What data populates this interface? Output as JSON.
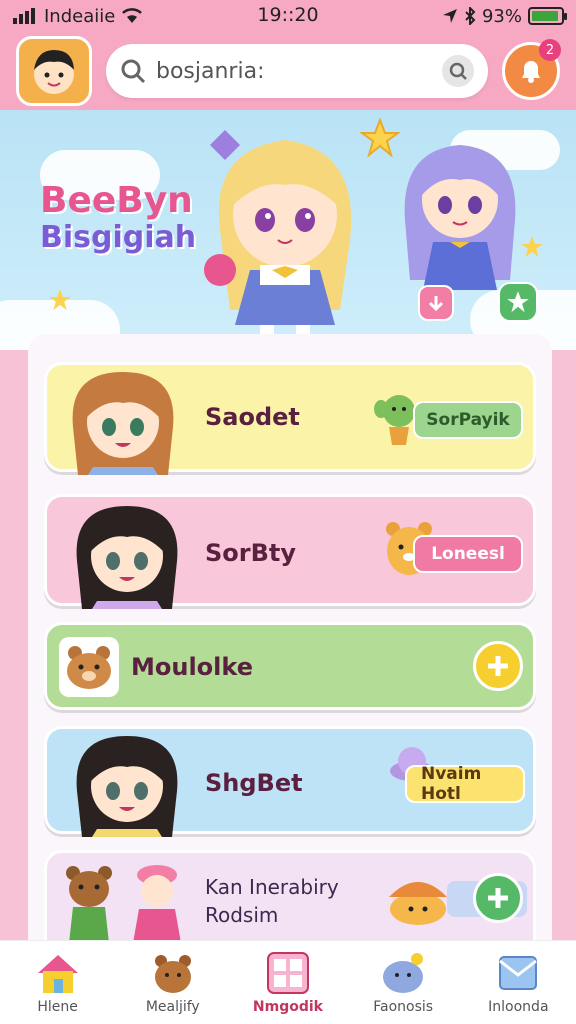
{
  "status": {
    "carrier": "Indeaiie",
    "time": "19::20",
    "battery_text": "93%",
    "battery_level": 0.93
  },
  "header": {
    "search_text": "bosjanria:",
    "notification_count": "2"
  },
  "hero": {
    "title_line1": "BeeByn",
    "title_line2": "Bisgigiah"
  },
  "cards": [
    {
      "title": "Saodet",
      "pill": "SorPayik",
      "color": "#fbf3a7",
      "pill_color": "#9cd58e"
    },
    {
      "title": "SorBty",
      "pill": "Loneesl",
      "color": "#f9c7da",
      "pill_color": "#f07aa3"
    },
    {
      "title": "Moulolke",
      "color": "#b3dd97"
    },
    {
      "title": "ShgBet",
      "pill": "Nvaim Hotl",
      "color": "#bfe3f6",
      "pill_color": "#fce36f"
    },
    {
      "title": "Kan Inerabiry",
      "subtitle": "Rodsim",
      "color": "#f3e2f3"
    }
  ],
  "nav": [
    {
      "label": "Hlene",
      "icon": "house-icon"
    },
    {
      "label": "Mealjify",
      "icon": "bear-icon"
    },
    {
      "label": "Nmgodik",
      "icon": "grid-icon"
    },
    {
      "label": "Faonosis",
      "icon": "cloud-creature-icon"
    },
    {
      "label": "Inloonda",
      "icon": "envelope-icon"
    }
  ]
}
